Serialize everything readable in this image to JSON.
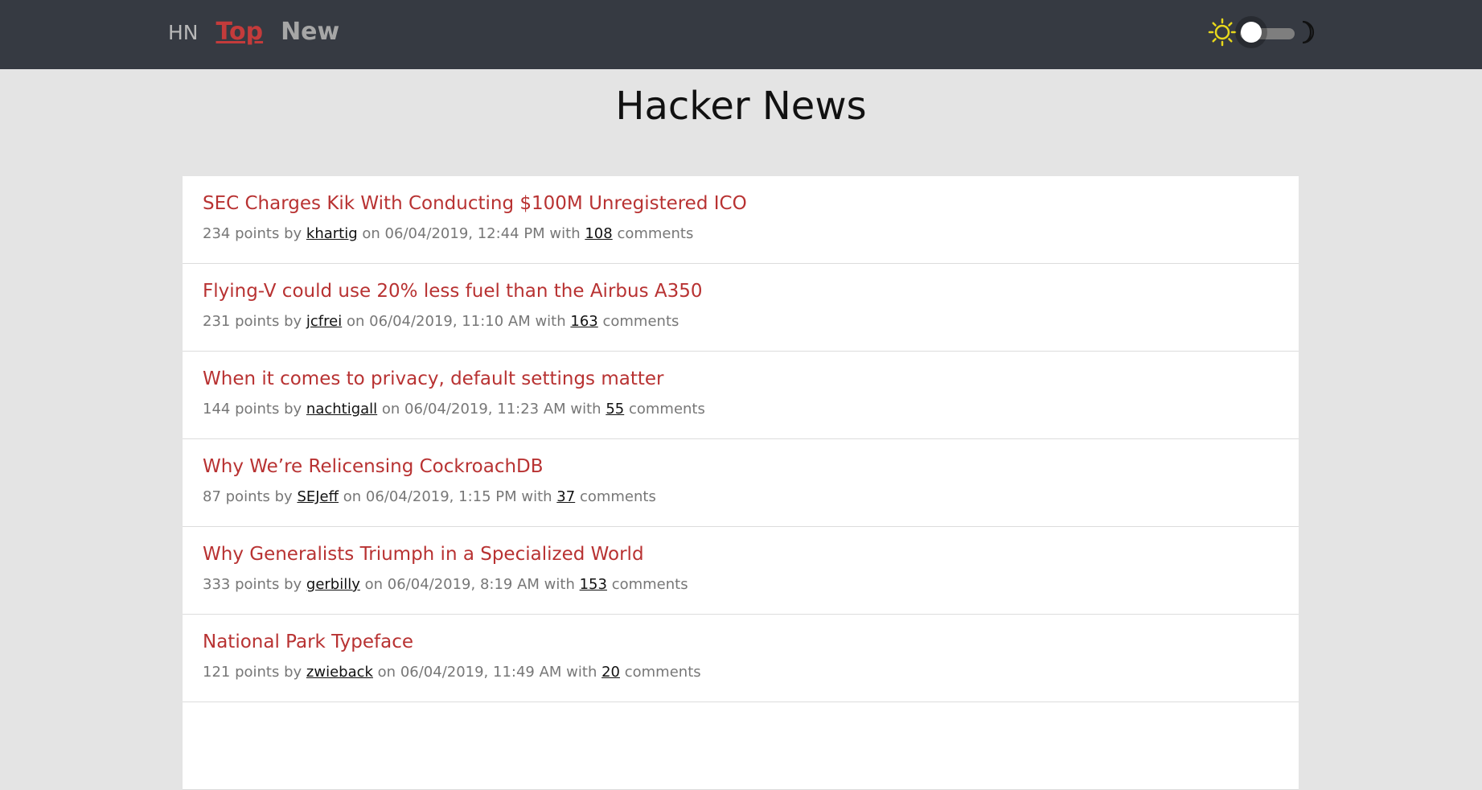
{
  "nav": {
    "brand": "HN",
    "tabs": [
      {
        "label": "Top",
        "active": true
      },
      {
        "label": "New",
        "active": false
      }
    ]
  },
  "theme_toggle": {
    "light_icon": "sun-icon",
    "dark_icon": "moon-icon",
    "mode": "light"
  },
  "page": {
    "title": "Hacker News"
  },
  "colors": {
    "accent": "#b83232",
    "topbar": "#363a42",
    "background": "#e4e4e4"
  },
  "stories": [
    {
      "title": "SEC Charges Kik With Conducting $100M Unregistered ICO",
      "points": "234 points by",
      "author": "khartig",
      "date": "on 06/04/2019, 12:44 PM with",
      "comments": "108",
      "comments_label": "comments"
    },
    {
      "title": "Flying-V could use 20% less fuel than the Airbus A350",
      "points": "231 points by",
      "author": "jcfrei",
      "date": "on 06/04/2019, 11:10 AM with",
      "comments": "163",
      "comments_label": "comments"
    },
    {
      "title": "When it comes to privacy, default settings matter",
      "points": "144 points by",
      "author": "nachtigall",
      "date": "on 06/04/2019, 11:23 AM with",
      "comments": "55",
      "comments_label": "comments"
    },
    {
      "title": "Why We’re Relicensing CockroachDB",
      "points": "87 points by",
      "author": "SEJeff",
      "date": "on 06/04/2019, 1:15 PM with",
      "comments": "37",
      "comments_label": "comments"
    },
    {
      "title": "Why Generalists Triumph in a Specialized World",
      "points": "333 points by",
      "author": "gerbilly",
      "date": "on 06/04/2019, 8:19 AM with",
      "comments": "153",
      "comments_label": "comments"
    },
    {
      "title": "National Park Typeface",
      "points": "121 points by",
      "author": "zwieback",
      "date": "on 06/04/2019, 11:49 AM with",
      "comments": "20",
      "comments_label": "comments"
    }
  ]
}
